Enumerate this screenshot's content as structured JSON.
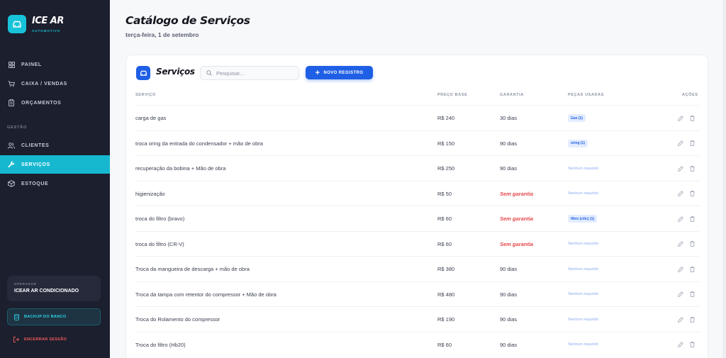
{
  "brand": {
    "name": "ICE AR",
    "subtitle": "AUTOMOTIVO",
    "icon": "car-icon",
    "accent": "#17c3d8"
  },
  "nav": {
    "items": [
      {
        "label": "PAINEL",
        "icon": "dashboard-icon"
      },
      {
        "label": "CAIXA / VENDAS",
        "icon": "cart-icon"
      },
      {
        "label": "ORÇAMENTOS",
        "icon": "clipboard-icon"
      }
    ],
    "section": "GESTÃO",
    "management": [
      {
        "label": "CLIENTES",
        "icon": "users-icon"
      },
      {
        "label": "SERVIÇOS",
        "icon": "wrench-icon",
        "active": true
      },
      {
        "label": "ESTOQUE",
        "icon": "box-icon"
      }
    ]
  },
  "operator": {
    "label": "OPERADOR",
    "name": "ICEAR AR CONDICIONADO"
  },
  "backup_label": "BACKUP DO BANCO",
  "logout_label": "ENCERRAR SESSÃO",
  "header": {
    "title": "Catálogo de Serviços",
    "date": "terça-feira, 1 de setembro"
  },
  "card": {
    "title": "Serviços",
    "search_placeholder": "Pesquisar...",
    "new_button": "NOVO REGISTRO",
    "columns": {
      "service": "SERVIÇO",
      "price": "PREÇO BASE",
      "warranty": "GARANTIA",
      "parts": "PEÇAS USADAS",
      "actions": "AÇÕES"
    }
  },
  "rows": [
    {
      "name": "carga de gas",
      "price": "R$ 240",
      "warranty": "30 dias",
      "parts": "Gas (1)"
    },
    {
      "name": "troca oring da entrada do condensador + mão de obra",
      "price": "R$ 150",
      "warranty": "90 dias",
      "parts": "oring (1)"
    },
    {
      "name": "recuperação da bobina + Mão de obra",
      "price": "R$ 250",
      "warranty": "90 dias",
      "parts": null
    },
    {
      "name": "higienização",
      "price": "R$ 50",
      "warranty": null,
      "parts": null
    },
    {
      "name": "troca do filtro (bravo)",
      "price": "R$ 60",
      "warranty": null,
      "parts": "filtro (cilic) (1)"
    },
    {
      "name": "troca do filtro (CR-V)",
      "price": "R$ 60",
      "warranty": null,
      "parts": null
    },
    {
      "name": "Troca da mangueira de descarga + mão de obra",
      "price": "R$ 380",
      "warranty": "90 dias",
      "parts": null
    },
    {
      "name": "Troca da tampa com retentor do compressor + Mão de obra",
      "price": "R$ 480",
      "warranty": "90 dias",
      "parts": null
    },
    {
      "name": "Troca do Rolamento do compressor",
      "price": "R$ 190",
      "warranty": "90 dias",
      "parts": null
    },
    {
      "name": "Troca do filtro (Hb20)",
      "price": "R$ 60",
      "warranty": "90 dias",
      "parts": null
    }
  ],
  "no_warranty_text": "Sem garantia",
  "no_parts_text": "Nenhum requisito",
  "colors": {
    "sidebar": "#1c1f2e",
    "active": "#16b8d0",
    "primary": "#1f5fe6",
    "danger": "#e5484d"
  }
}
